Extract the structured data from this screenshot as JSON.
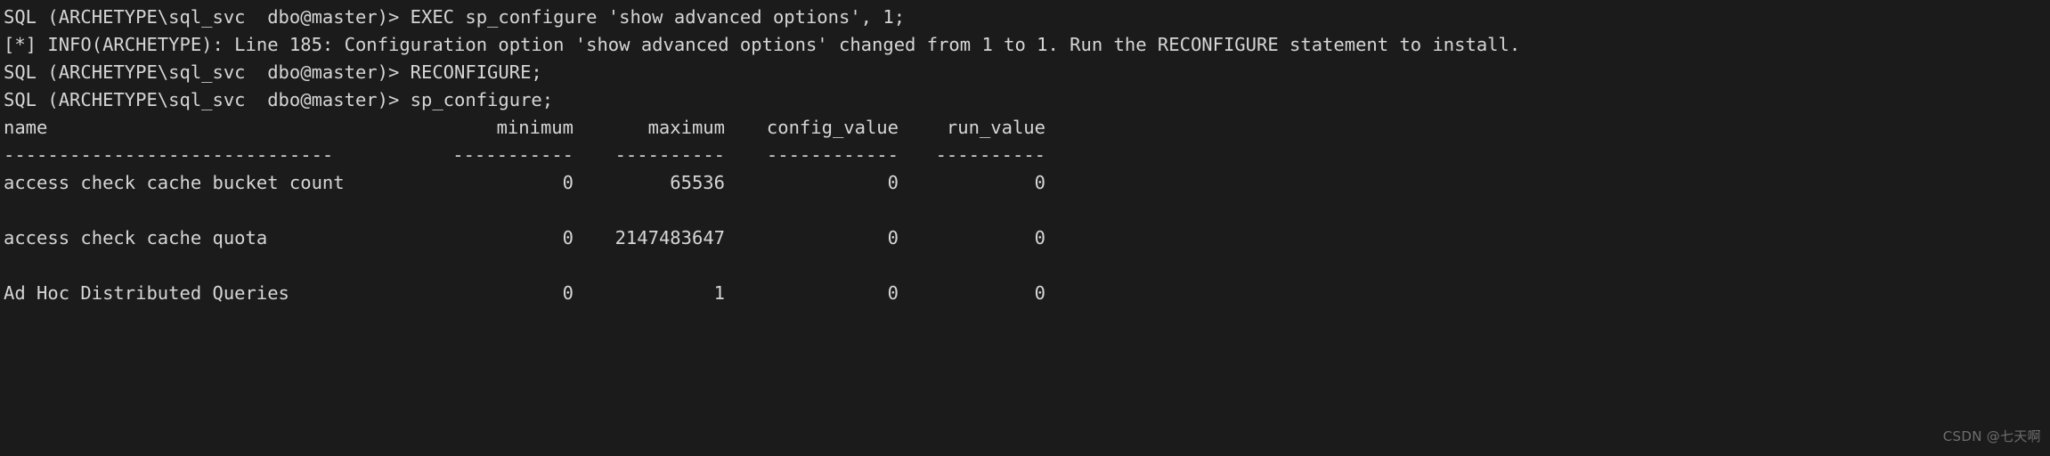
{
  "terminal": {
    "background_color": "#1b1b1b",
    "foreground_color": "#d6d6d6",
    "prompt": "SQL (ARCHETYPE\\sql_svc  dbo@master)> ",
    "lines": [
      "SQL (ARCHETYPE\\sql_svc  dbo@master)> EXEC sp_configure 'show advanced options', 1;",
      "[*] INFO(ARCHETYPE): Line 185: Configuration option 'show advanced options' changed from 1 to 1. Run the RECONFIGURE statement to install.",
      "SQL (ARCHETYPE\\sql_svc  dbo@master)> RECONFIGURE;",
      "SQL (ARCHETYPE\\sql_svc  dbo@master)> sp_configure;"
    ],
    "commands": [
      "EXEC sp_configure 'show advanced options', 1;",
      "RECONFIGURE;",
      "sp_configure;"
    ],
    "info_message": "[*] INFO(ARCHETYPE): Line 185: Configuration option 'show advanced options' changed from 1 to 1. Run the RECONFIGURE statement to install."
  },
  "table": {
    "headers": {
      "name": "name",
      "minimum": "minimum",
      "maximum": "maximum",
      "config_value": "config_value",
      "run_value": "run_value"
    },
    "separators": {
      "name": "------------------------------",
      "minimum": "-----------",
      "maximum": "----------",
      "config_value": "------------",
      "run_value": "----------"
    },
    "rows": [
      {
        "name": "access check cache bucket count",
        "minimum": "0",
        "maximum": "65536",
        "config_value": "0",
        "run_value": "0"
      },
      {
        "name": "access check cache quota",
        "minimum": "0",
        "maximum": "2147483647",
        "config_value": "0",
        "run_value": "0"
      },
      {
        "name": "Ad Hoc Distributed Queries",
        "minimum": "0",
        "maximum": "1",
        "config_value": "0",
        "run_value": "0"
      }
    ]
  },
  "watermark": {
    "text": "CSDN @七天啊",
    "color": "#6d6d6d"
  }
}
